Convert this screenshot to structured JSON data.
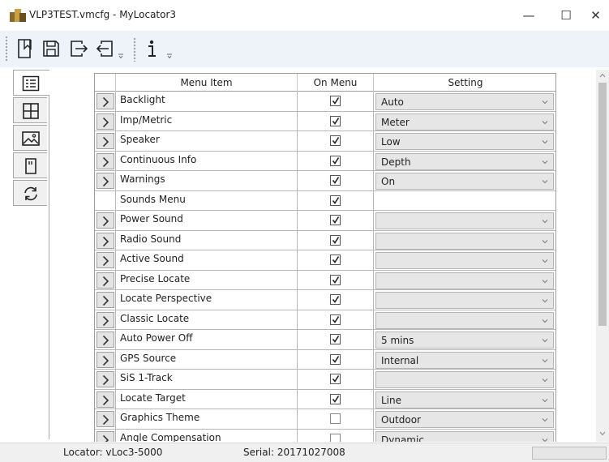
{
  "window": {
    "title": "VLP3TEST.vmcfg - MyLocator3",
    "minimize_glyph": "—",
    "maximize_glyph": "☐",
    "close_glyph": "✕"
  },
  "toolbar": {
    "buttons": [
      {
        "icon": "new-file-icon"
      },
      {
        "icon": "save-icon"
      },
      {
        "icon": "export-icon"
      },
      {
        "icon": "import-icon"
      },
      {
        "icon": "info-icon"
      }
    ]
  },
  "side_tabs": [
    {
      "icon": "menu-list-icon",
      "active": true
    },
    {
      "icon": "grid-icon",
      "active": false
    },
    {
      "icon": "image-icon",
      "active": false
    },
    {
      "icon": "sd-card-icon",
      "active": false
    },
    {
      "icon": "refresh-icon",
      "active": false
    }
  ],
  "grid": {
    "headers": {
      "item": "Menu Item",
      "on_menu": "On Menu",
      "setting": "Setting"
    },
    "rows": [
      {
        "label": "Backlight",
        "expander": true,
        "on_menu": true,
        "setting": "Auto",
        "combo": true
      },
      {
        "label": "Imp/Metric",
        "expander": true,
        "on_menu": true,
        "setting": "Meter",
        "combo": true
      },
      {
        "label": "Speaker",
        "expander": true,
        "on_menu": true,
        "setting": "Low",
        "combo": true
      },
      {
        "label": "Continuous Info",
        "expander": true,
        "on_menu": true,
        "setting": "Depth",
        "combo": true
      },
      {
        "label": "Warnings",
        "expander": true,
        "on_menu": true,
        "setting": "On",
        "combo": true
      },
      {
        "label": "Sounds Menu",
        "expander": false,
        "on_menu": true,
        "setting": "",
        "combo": false
      },
      {
        "label": "Power Sound",
        "expander": true,
        "on_menu": true,
        "setting": "",
        "combo": true
      },
      {
        "label": "Radio Sound",
        "expander": true,
        "on_menu": true,
        "setting": "",
        "combo": true
      },
      {
        "label": "Active Sound",
        "expander": true,
        "on_menu": true,
        "setting": "",
        "combo": true
      },
      {
        "label": "Precise Locate",
        "expander": true,
        "on_menu": true,
        "setting": "",
        "combo": true
      },
      {
        "label": "Locate Perspective",
        "expander": true,
        "on_menu": true,
        "setting": "",
        "combo": true
      },
      {
        "label": "Classic Locate",
        "expander": true,
        "on_menu": true,
        "setting": "",
        "combo": true
      },
      {
        "label": "Auto Power Off",
        "expander": true,
        "on_menu": true,
        "setting": "5 mins",
        "combo": true
      },
      {
        "label": "GPS Source",
        "expander": true,
        "on_menu": true,
        "setting": "Internal",
        "combo": true
      },
      {
        "label": "SiS 1-Track",
        "expander": true,
        "on_menu": true,
        "setting": "",
        "combo": true
      },
      {
        "label": "Locate Target",
        "expander": true,
        "on_menu": true,
        "setting": "Line",
        "combo": true
      },
      {
        "label": "Graphics Theme",
        "expander": true,
        "on_menu": false,
        "setting": "Outdoor",
        "combo": true
      },
      {
        "label": "Angle Compensation",
        "expander": true,
        "on_menu": false,
        "setting": "Dynamic",
        "combo": true
      }
    ]
  },
  "status": {
    "locator": "Locator:  vLoc3-5000",
    "serial": "Serial:  20171027008"
  },
  "colors": {
    "toolbar_bg": "#eef2f9",
    "combo_bg": "#e6e6e6",
    "grid_border": "#9e9e9e"
  }
}
